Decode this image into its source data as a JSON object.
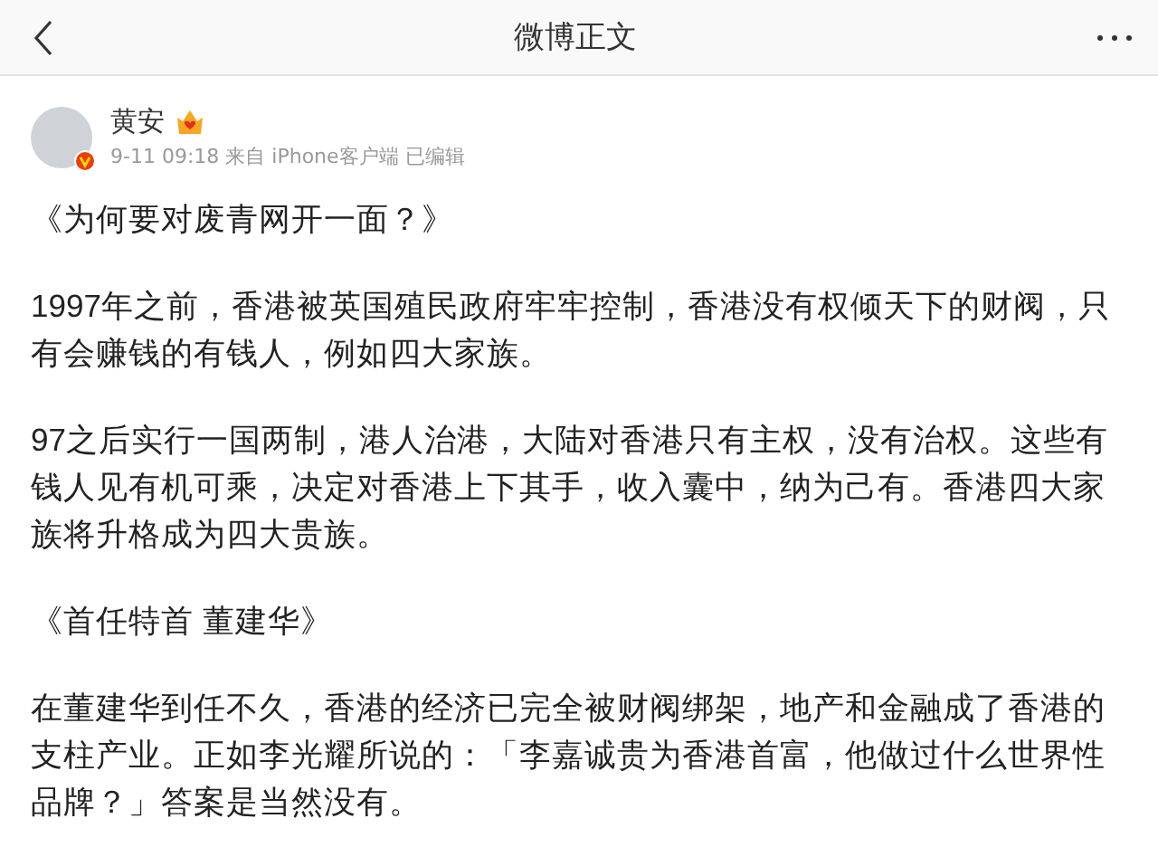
{
  "header": {
    "title": "微博正文"
  },
  "post": {
    "author": "黄安",
    "meta": "9-11 09:18 来自 iPhone客户端 已编辑",
    "paragraphs": [
      "《为何要对废青网开一面？》",
      "1997年之前，香港被英国殖民政府牢牢控制，香港没有权倾天下的财阀，只有会赚钱的有钱人，例如四大家族。",
      "97之后实行一国两制，港人治港，大陆对香港只有主权，没有治权。这些有钱人见有机可乘，决定对香港上下其手，收入囊中，纳为己有。香港四大家族将升格成为四大贵族。",
      "《首任特首 董建华》",
      "在董建华到任不久，香港的经济已完全被财阀绑架，地产和金融成了香港的支柱产业。正如李光耀所说的：「李嘉诚贵为香港首富，他做过什么世界性品牌？」答案是当然没有。"
    ]
  }
}
